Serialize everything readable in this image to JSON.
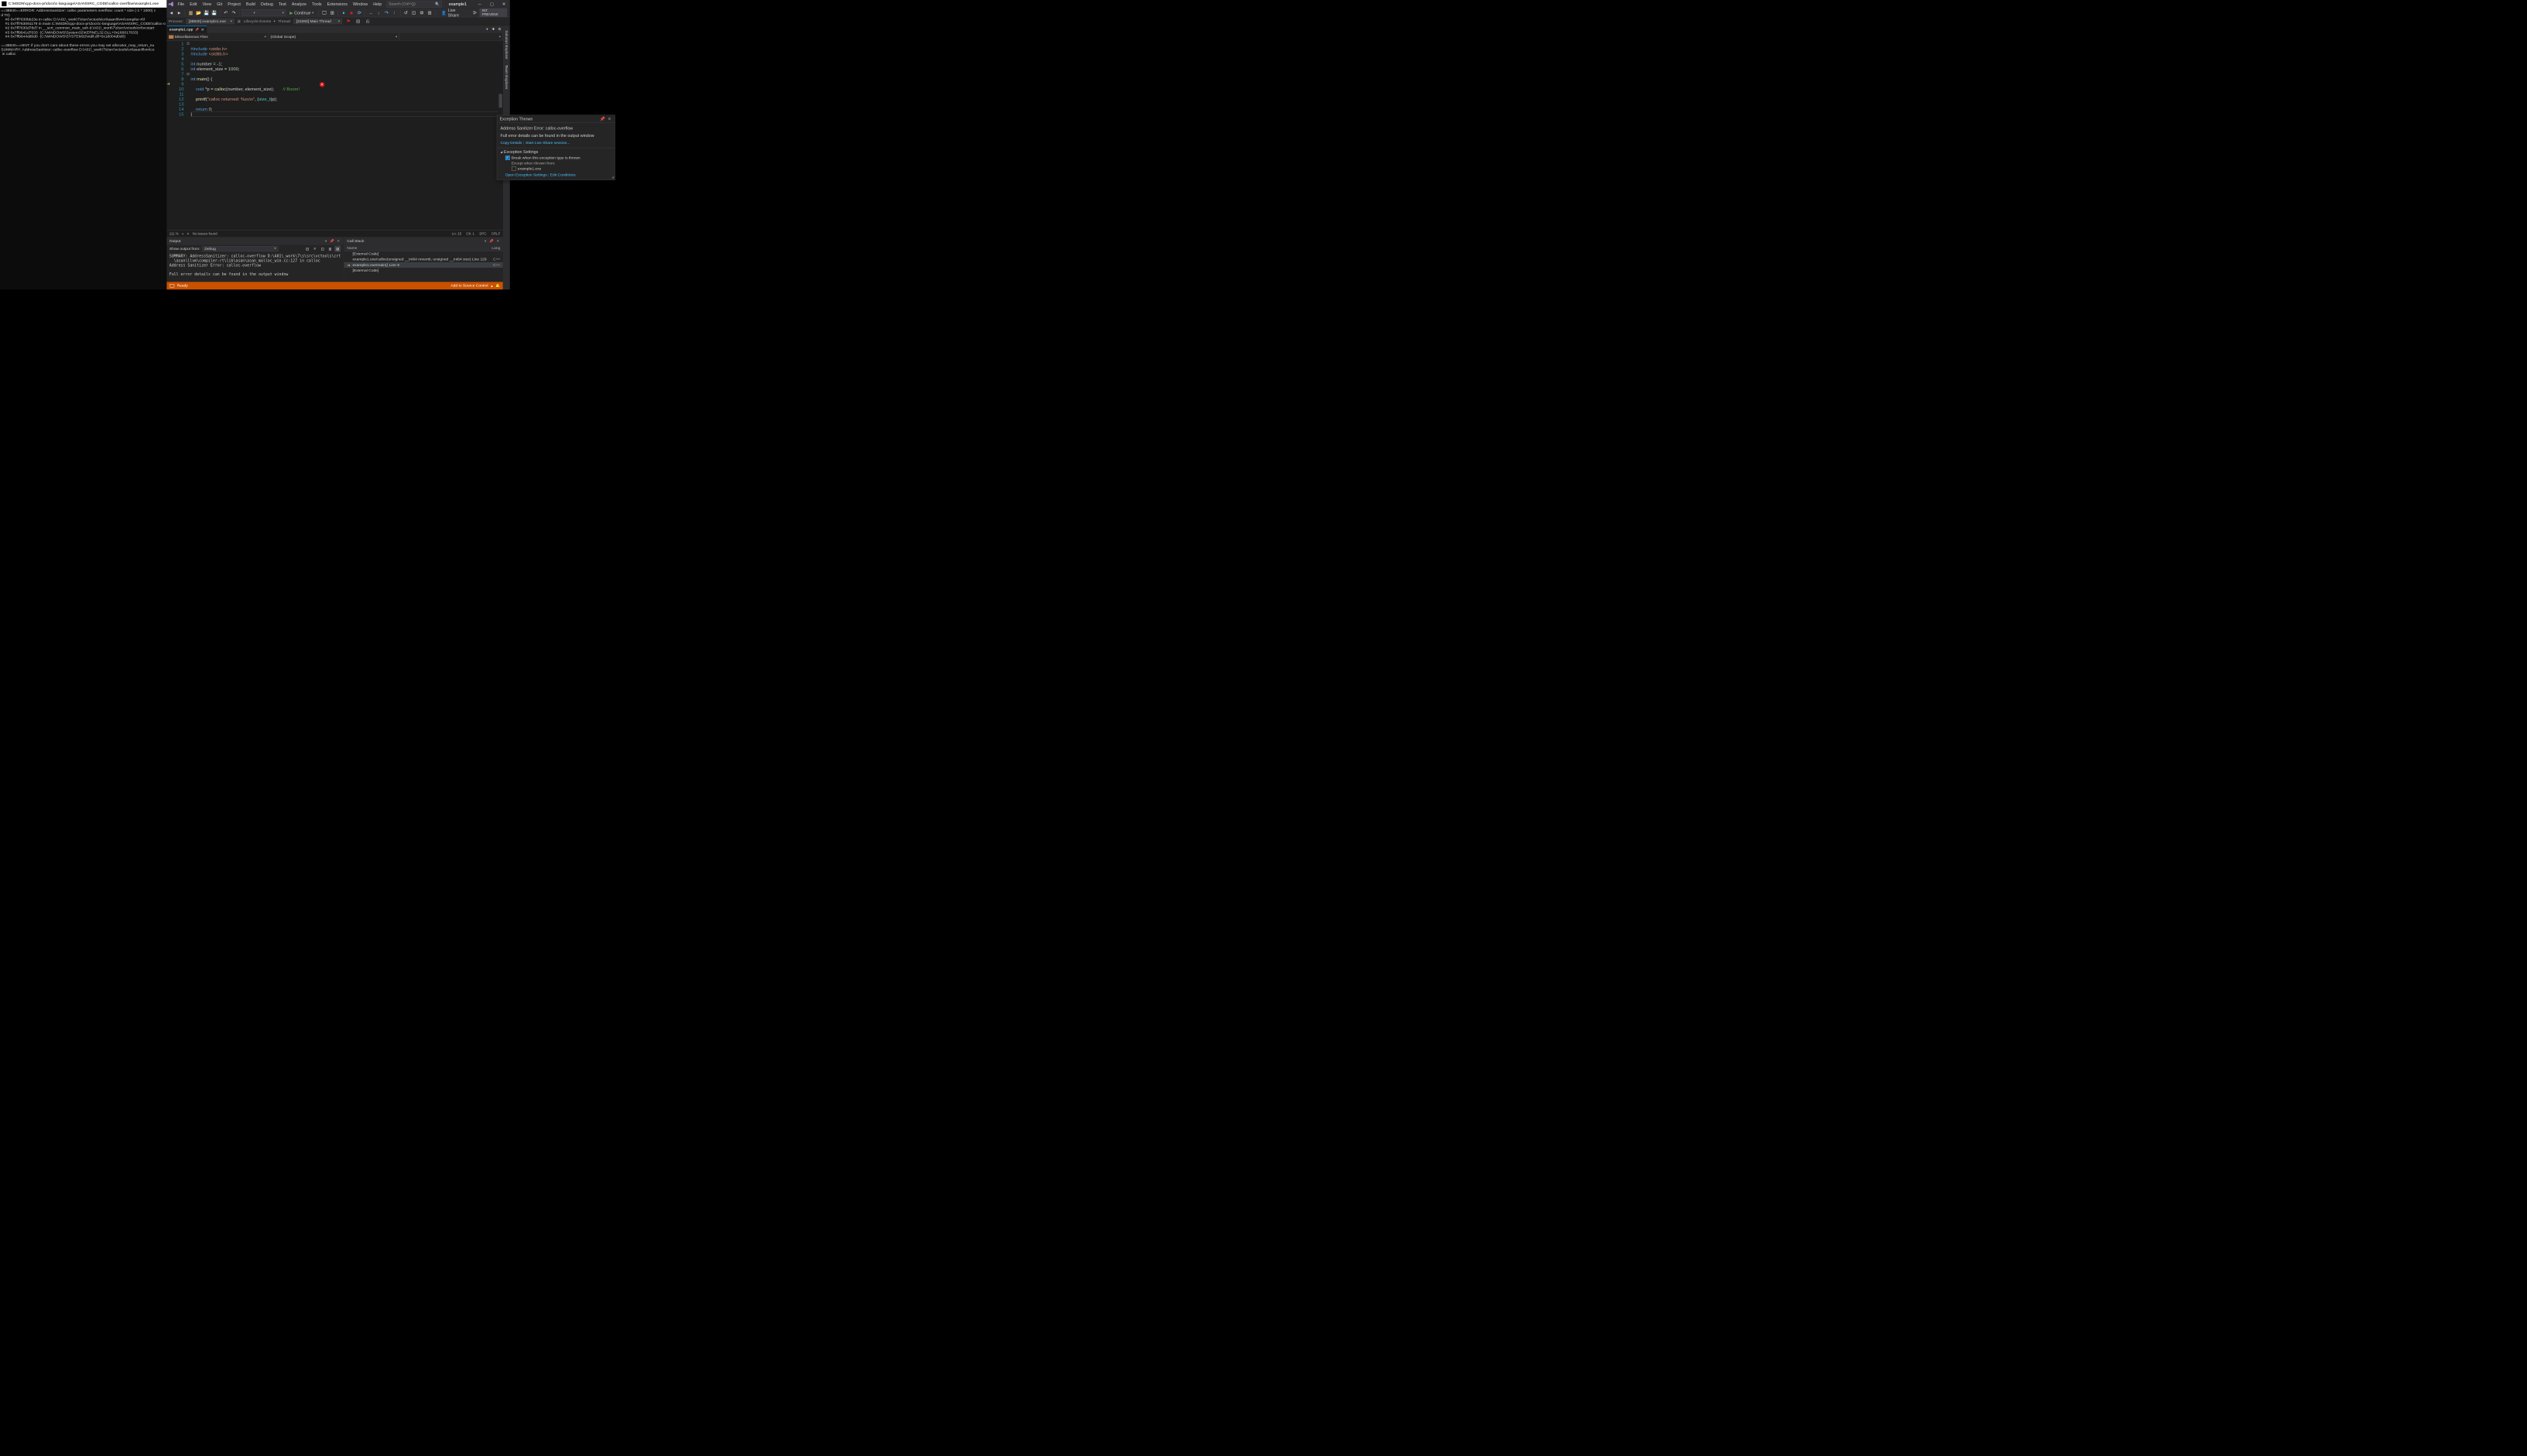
{
  "console": {
    "title": "C:\\MSDN\\cpp-docs-pr\\docs\\c-language\\ASAN\\SRC_CODE\\calloc-overflow\\example1.exe",
    "body": "==38840==ERROR: AddressSanitizer: calloc parameters overflow: count * size (-1 * 1000) c\nd T0)\n    #0 0x7ff7630bb23e in calloc D:\\A01\\_work\\7\\s\\src\\vctools\\crt\\asan\\llvm\\compiler-rt\\l\n    #1 0x7ff763091179 in main C:\\MSDN\\cpp-docs-pr\\docs\\c-language\\ASAN\\SRC_CODE\\calloc-o\n    #2 0x7ff7630d78d7 in __scrt_common_main_seh d:\\A01\\_work\\7\\s\\src\\vctools\\crt\\vcstart\n    #3 0x7ff9641d7033  (C:\\WINDOWS\\System32\\KERNEL32.DLL+0x180017033)\n    #4 0x7ff9644dd0d0  (C:\\WINDOWS\\SYSTEM32\\ntdll.dll+0x18004d0d0)\n\n==38840==HINT: if you don't care about these errors you may set allocator_may_return_nu\nSUMMARY: AddressSanitizer: calloc-overflow D:\\A01\\_work\\7\\s\\src\\vctools\\crt\\asan\\llvm\\co\n in calloc"
  },
  "menu": [
    "File",
    "Edit",
    "View",
    "Git",
    "Project",
    "Build",
    "Debug",
    "Test",
    "Analyze",
    "Tools",
    "Extensions",
    "Window",
    "Help"
  ],
  "search_placeholder": "Search (Ctrl+Q)",
  "solution_name": "example1",
  "toolbar": {
    "continue": "Continue",
    "live_share": "Live Share",
    "int_preview": "INT PREVIEW"
  },
  "debugbar": {
    "process_label": "Process:",
    "process_value": "[38840] example1.exe",
    "lifecycle": "Lifecycle Events",
    "thread_label": "Thread:",
    "thread_value": "[22260] Main Thread"
  },
  "tab": {
    "name": "example1.cpp"
  },
  "navbar": {
    "left": "Miscellaneous Files",
    "right": "(Global Scope)"
  },
  "code": {
    "lines": [
      "#include <stdio.h>",
      "#include <stdlib.h>",
      "",
      "int number = -1;",
      "int element_size = 1000;",
      "",
      "int main() {",
      "",
      "    void *p = calloc(number, element_size);       // Boom!",
      "",
      "    printf(\"calloc returned: %zu\\n\", (size_t)p);",
      "",
      "    return 0;",
      "}",
      ""
    ]
  },
  "exception": {
    "title": "Exception Thrown",
    "msg": "Address Sanitizer Error: calloc-overflow",
    "detail": "Full error details can be found in the output window",
    "copy": "Copy Details",
    "start_live": "Start Live Share session...",
    "settings_hdr": "Exception Settings",
    "break_when": "Break when this exception type is thrown",
    "except_from": "Except when thrown from:",
    "exe": "example1.exe",
    "open_settings": "Open Exception Settings",
    "edit_cond": "Edit Conditions"
  },
  "status": {
    "zoom": "111 %",
    "issues": "No issues found",
    "pos": "Ln: 15",
    "ch": "Ch: 1",
    "spc": "SPC",
    "crlf": "CRLF"
  },
  "output": {
    "title": "Output",
    "show_from": "Show output from:",
    "source": "Debug",
    "text": "SUMMARY: AddressSanitizer: calloc-overflow D:\\A01\\_work\\7\\s\\src\\vctools\\crt\n  \\asan\\llvm\\compiler-rt\\lib\\asan\\asan_malloc_win.cc:127 in calloc\nAddress Sanitizer Error: calloc-overflow\n\nFull error details can be found in the output window"
  },
  "callstack": {
    "title": "Call Stack",
    "name_hdr": "Name",
    "lang_hdr": "Lang",
    "rows": [
      {
        "name": "[External Code]",
        "lang": "",
        "active": false,
        "arrow": ""
      },
      {
        "name": "example1.exe!calloc(unsigned __int64 nmemb, unsigned __int64 size) Line 129",
        "lang": "C++",
        "active": false,
        "arrow": ""
      },
      {
        "name": "example1.exe!main() Line 9",
        "lang": "C++",
        "active": true,
        "arrow": "➜"
      },
      {
        "name": "[External Code]",
        "lang": "",
        "active": false,
        "arrow": ""
      }
    ]
  },
  "statusbar": {
    "ready": "Ready",
    "src_control": "Add to Source Control"
  },
  "side_tabs": [
    "Solution Explorer",
    "Team Explorer"
  ]
}
